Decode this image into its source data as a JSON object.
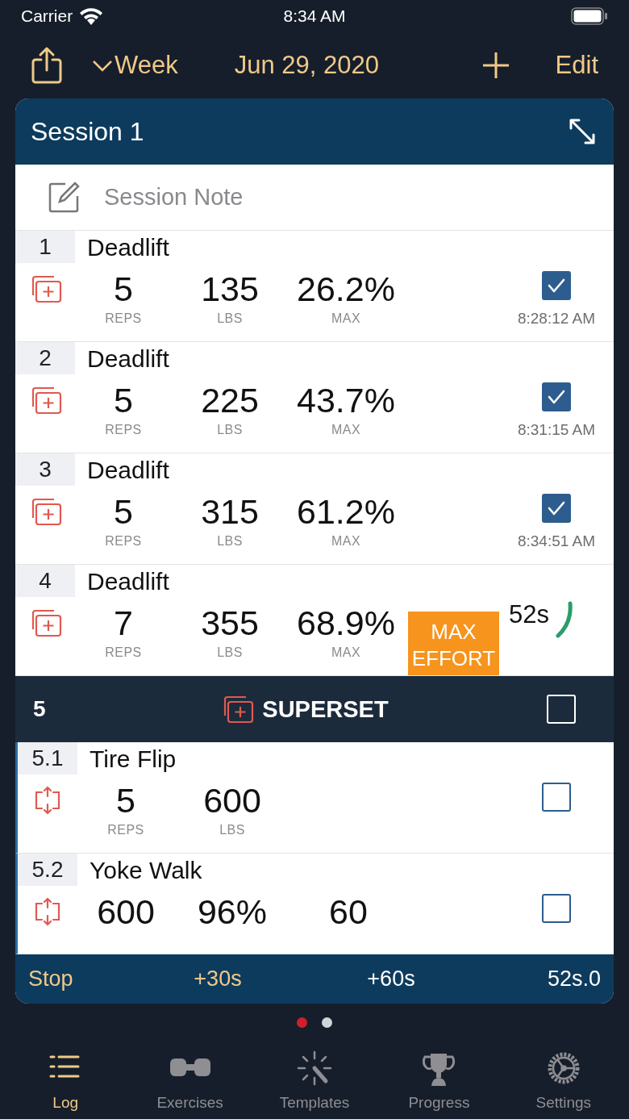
{
  "status_bar": {
    "carrier": "Carrier",
    "time": "8:34 AM"
  },
  "nav": {
    "range": "Week",
    "date": "Jun 29, 2020",
    "edit": "Edit"
  },
  "session": {
    "title": "Session 1",
    "note": {
      "placeholder": "Session Note"
    }
  },
  "sets": [
    {
      "kind": "set",
      "number": "1",
      "name": "Deadlift",
      "values": [
        {
          "value": "5",
          "unit": "REPS"
        },
        {
          "value": "135",
          "unit": "LBS"
        },
        {
          "value": "26.2%",
          "unit": "MAX"
        }
      ],
      "checked": true,
      "time": "8:28:12 AM"
    },
    {
      "kind": "set",
      "number": "2",
      "name": "Deadlift",
      "values": [
        {
          "value": "5",
          "unit": "REPS"
        },
        {
          "value": "225",
          "unit": "LBS"
        },
        {
          "value": "43.7%",
          "unit": "MAX"
        }
      ],
      "checked": true,
      "time": "8:31:15 AM"
    },
    {
      "kind": "set",
      "number": "3",
      "name": "Deadlift",
      "values": [
        {
          "value": "5",
          "unit": "REPS"
        },
        {
          "value": "315",
          "unit": "LBS"
        },
        {
          "value": "61.2%",
          "unit": "MAX"
        }
      ],
      "checked": true,
      "time": "8:34:51 AM"
    },
    {
      "kind": "set",
      "number": "4",
      "name": "Deadlift",
      "values": [
        {
          "value": "7",
          "unit": "REPS"
        },
        {
          "value": "355",
          "unit": "LBS"
        },
        {
          "value": "68.9%",
          "unit": "MAX"
        }
      ],
      "badge": "MAX EFFORT",
      "timer": "52s"
    },
    {
      "kind": "superset",
      "number": "5",
      "label": "SUPERSET",
      "checked": false,
      "children": [
        {
          "number": "5.1",
          "name": "Tire Flip",
          "values": [
            {
              "value": "5",
              "unit": "REPS"
            },
            {
              "value": "600",
              "unit": "LBS"
            }
          ],
          "checked": false
        },
        {
          "number": "5.2",
          "name": "Yoke Walk",
          "values": [
            {
              "value": "600"
            },
            {
              "value": "96%"
            },
            {
              "value": "60"
            }
          ],
          "checked": false
        }
      ]
    }
  ],
  "timer_bar": {
    "stop": "Stop",
    "add30": "+30s",
    "add60": "+60s",
    "remaining": "52s.0"
  },
  "pages": [
    {
      "selected": true
    },
    {
      "selected": false
    }
  ],
  "tabs": [
    {
      "label": "Log",
      "selected": true
    },
    {
      "label": "Exercises",
      "selected": false
    },
    {
      "label": "Templates",
      "selected": false
    },
    {
      "label": "Progress",
      "selected": false
    },
    {
      "label": "Settings",
      "selected": false
    }
  ]
}
